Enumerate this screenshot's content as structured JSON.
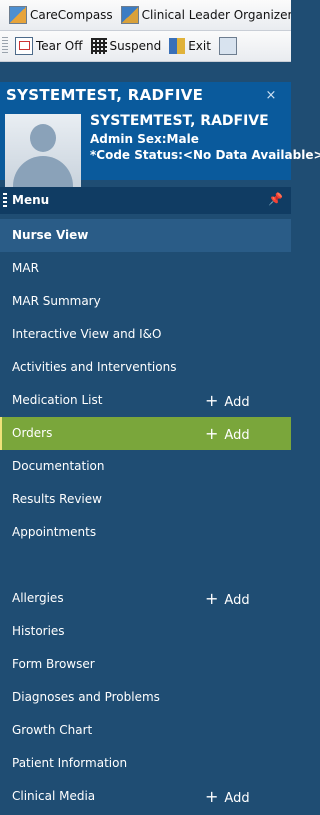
{
  "toolbar1": {
    "items": [
      {
        "label": "CareCompass",
        "icon": "carecompass-icon"
      },
      {
        "label": "Clinical Leader Organizer",
        "icon": "clinical-leader-icon"
      }
    ]
  },
  "toolbar2": {
    "items": [
      {
        "label": "Tear Off",
        "icon": "tear-off-icon"
      },
      {
        "label": "Suspend",
        "icon": "suspend-icon"
      },
      {
        "label": "Exit",
        "icon": "exit-icon"
      },
      {
        "label": "Calculator",
        "icon": "calculator-icon"
      }
    ]
  },
  "banner": {
    "title": "SYSTEMTEST, RADFIVE",
    "name": "SYSTEMTEST, RADFIVE",
    "sex": "Admin Sex:Male",
    "code_status": "*Code Status:<No Data Available>",
    "close_glyph": "×"
  },
  "menu": {
    "title": "Menu",
    "pin_glyph": "📌",
    "items": [
      {
        "label": "Nurse View",
        "active": true
      },
      {
        "label": "MAR"
      },
      {
        "label": "MAR Summary"
      },
      {
        "label": "Interactive View and I&O"
      },
      {
        "label": "Activities and Interventions"
      },
      {
        "label": "Medication List",
        "add": "Add"
      },
      {
        "label": "Orders",
        "add": "Add",
        "highlight": true
      },
      {
        "label": "Documentation"
      },
      {
        "label": "Results Review"
      },
      {
        "label": "Appointments"
      },
      {
        "label": "",
        "spacer": true
      },
      {
        "label": "Allergies",
        "add": "Add"
      },
      {
        "label": "Histories"
      },
      {
        "label": "Form Browser"
      },
      {
        "label": "Diagnoses and Problems"
      },
      {
        "label": "Growth Chart"
      },
      {
        "label": "Patient Information"
      },
      {
        "label": "Clinical Media",
        "add": "Add"
      }
    ]
  },
  "colors": {
    "banner_bg": "#0a5a9c",
    "menu_bg": "#1f4d73",
    "highlight_bg": "#7aa63b"
  }
}
